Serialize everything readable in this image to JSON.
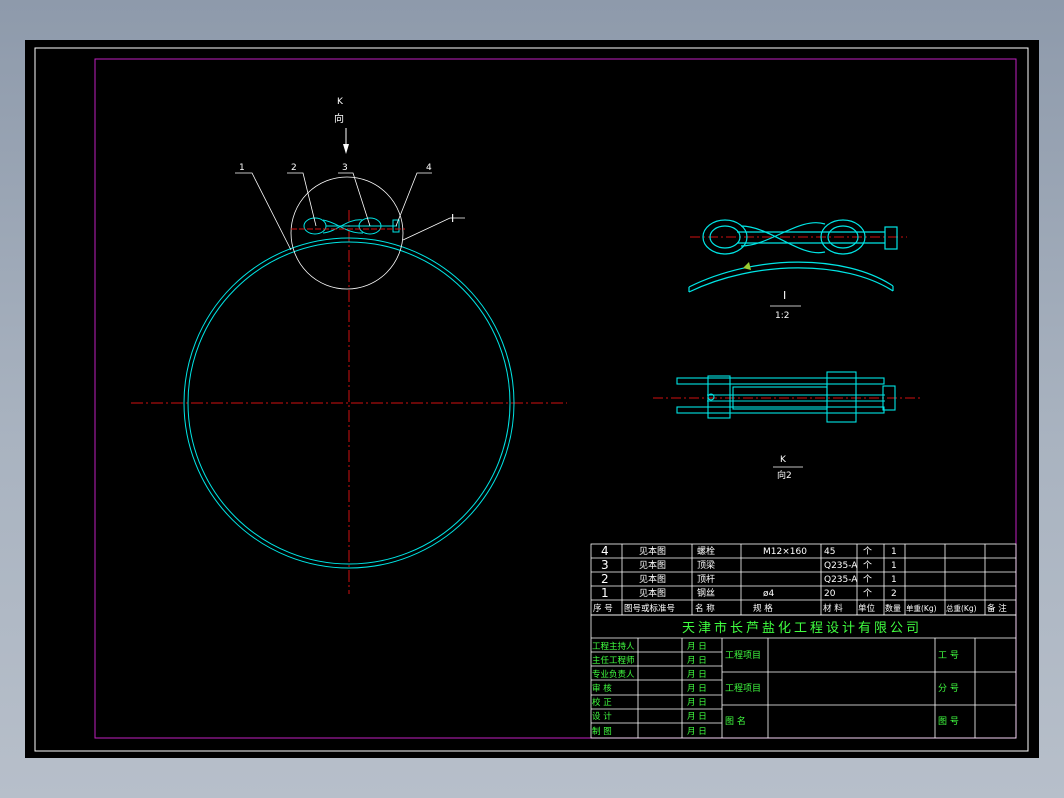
{
  "colors": {
    "background": "#000000",
    "frame": "#ffffff",
    "border": "#c020c0",
    "part": "#00e5e5",
    "centerline": "#d01010",
    "text": "#ffffff",
    "title_text": "#40ff40",
    "table_lines": "#ffffff"
  },
  "main_view": {
    "view_arrow_letter": "K",
    "view_arrow_word": "向",
    "balloons": [
      "1",
      "2",
      "3",
      "4"
    ],
    "detail_marker": "I"
  },
  "detail_view": {
    "name": "I",
    "scale": "1:2"
  },
  "k_view": {
    "name": "K",
    "caption": "向2"
  },
  "bom": {
    "rows": [
      {
        "seq": "4",
        "drawing": "见本图",
        "name": "螺栓",
        "spec": "M12×160",
        "material": "45",
        "unit": "个",
        "qty": "1"
      },
      {
        "seq": "3",
        "drawing": "见本图",
        "name": "顶梁",
        "spec": "",
        "material": "Q235-A",
        "unit": "个",
        "qty": "1"
      },
      {
        "seq": "2",
        "drawing": "见本图",
        "name": "顶杆",
        "spec": "",
        "material": "Q235-A",
        "unit": "个",
        "qty": "1"
      },
      {
        "seq": "1",
        "drawing": "见本图",
        "name": "钢丝",
        "spec": "ø4",
        "material": "20",
        "unit": "个",
        "qty": "2"
      }
    ],
    "header": {
      "seq": "序 号",
      "drawing": "图号或标准号",
      "name": "名   称",
      "spec": "规      格",
      "material": "材 料",
      "unit": "单位",
      "qty": "数量",
      "single_weight": "单重(Kg)",
      "total_weight": "总重(Kg)",
      "remark": "备 注"
    }
  },
  "title_block": {
    "company": "天津市长芦盐化工程设计有限公司",
    "roles": [
      "工程主持人",
      "主任工程师",
      "专业负责人",
      "审      核",
      "校      正",
      "设      计",
      "制      图"
    ],
    "date_label": "月  日",
    "project_label_1": "工程项目",
    "project_label_2": "工程项目",
    "drawing_name_label": "图   名",
    "work_no_label": "工   号",
    "sub_no_label": "分   号",
    "drawing_no_label": "图   号"
  }
}
